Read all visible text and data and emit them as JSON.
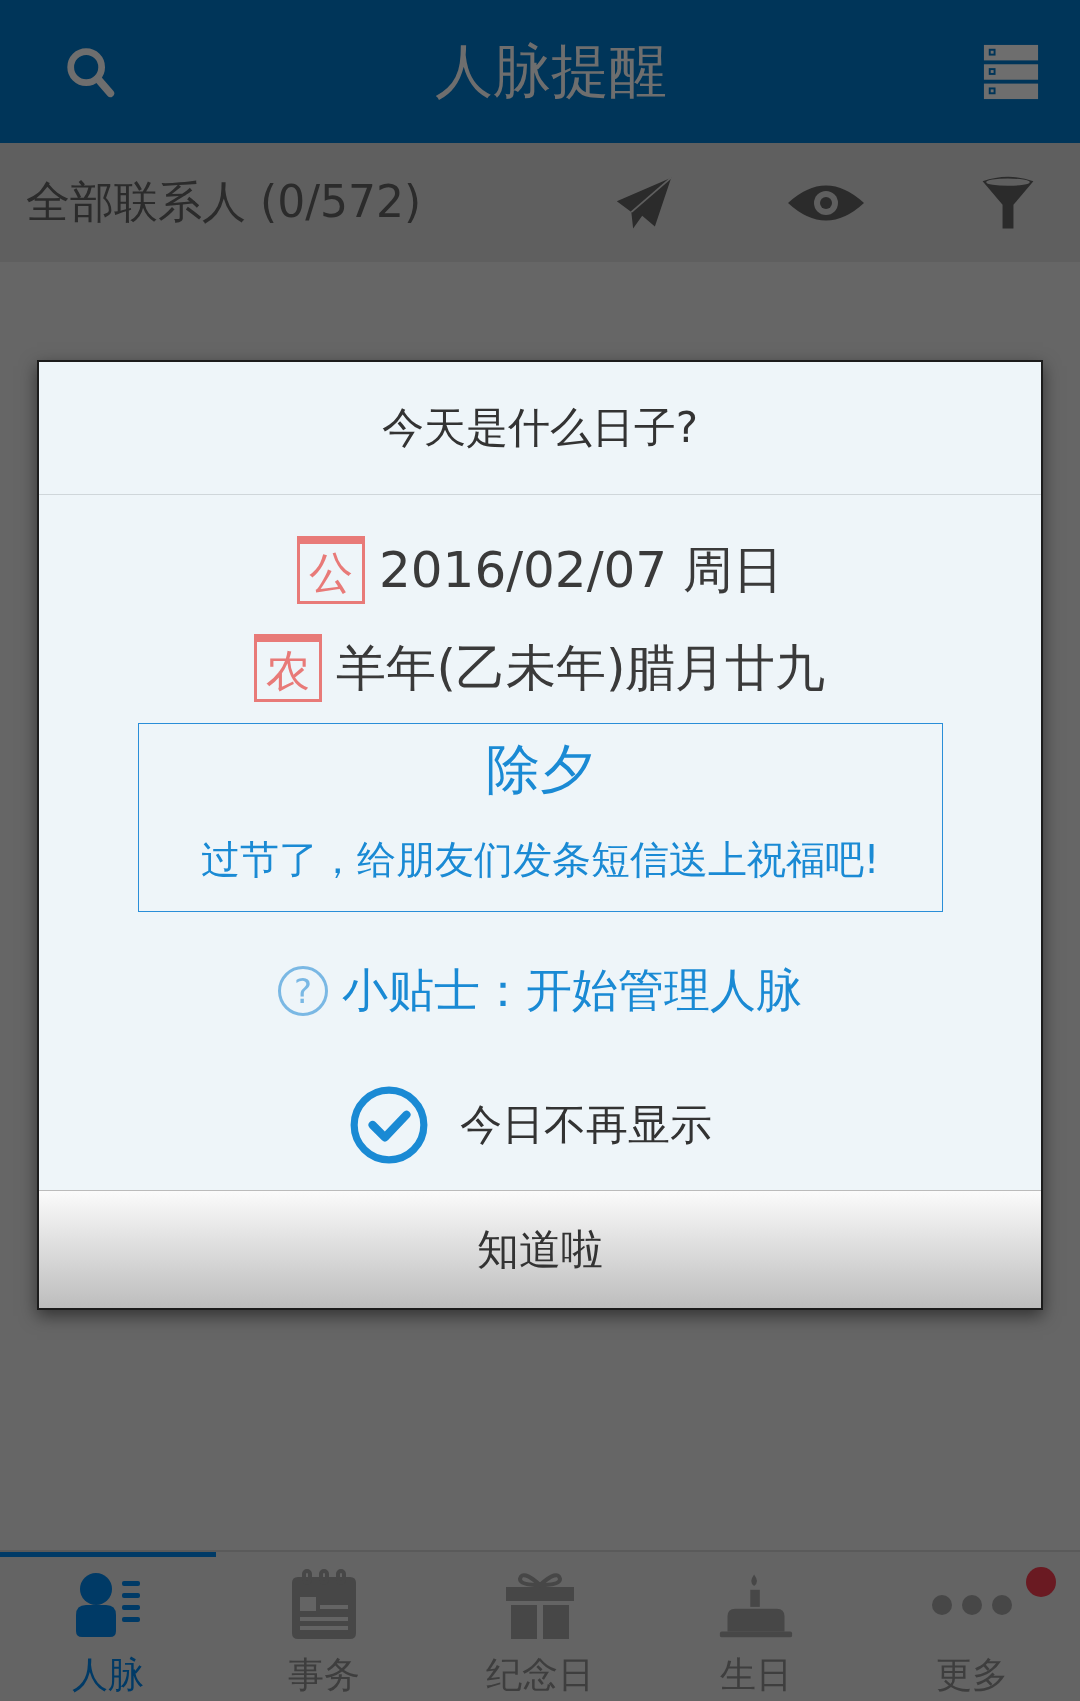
{
  "app_bar": {
    "title": "人脉提醒"
  },
  "filter_bar": {
    "label": "全部联系人 (0/572)"
  },
  "dialog": {
    "title": "今天是什么日子?",
    "solar": {
      "badge": "公",
      "text": "2016/02/07 周日"
    },
    "lunar": {
      "badge": "农",
      "text": "羊年(乙未年)腊月廿九"
    },
    "festival": {
      "name": "除夕",
      "message": "过节了，给朋友们发条短信送上祝福吧!"
    },
    "tip": {
      "icon": "?",
      "text": "小贴士：开始管理人脉"
    },
    "dont_show": {
      "label": "今日不再显示",
      "checked": true
    },
    "button": "知道啦"
  },
  "bottom_nav": [
    {
      "kind": "contacts",
      "label": "人脉",
      "selected": true,
      "notification": false
    },
    {
      "kind": "calendar",
      "label": "事务",
      "selected": false,
      "notification": false
    },
    {
      "kind": "gift",
      "label": "纪念日",
      "selected": false,
      "notification": false
    },
    {
      "kind": "cake",
      "label": "生日",
      "selected": false,
      "notification": false
    },
    {
      "kind": "more",
      "label": "更多",
      "selected": false,
      "notification": true
    }
  ]
}
